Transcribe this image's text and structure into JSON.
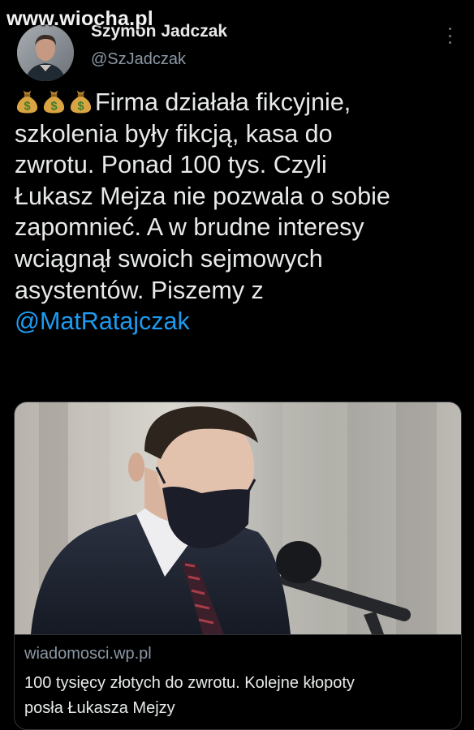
{
  "watermark": "www.wiocha.pl",
  "author": {
    "name": "Szymon Jadczak",
    "handle": "@SzJadczak"
  },
  "tweet": {
    "emoji_icons": [
      "money-bag-icon",
      "money-bag-icon",
      "money-bag-icon"
    ],
    "lines": [
      "Firma działała fikcyjnie,",
      "szkolenia były fikcją, kasa do",
      "zwrotu. Ponad 100 tys. Czyli",
      "Łukasz Mejza nie pozwala o sobie",
      "zapomnieć. A w brudne interesy",
      "wciągnął swoich sejmowych",
      "asystentów. Piszemy z"
    ],
    "mention": "@MatRatajczak"
  },
  "card": {
    "domain": "wiadomosci.wp.pl",
    "title_line1": "100 tysięcy złotych do zwrotu. Kolejne kłopoty",
    "title_line2": "posła Łukasza Mejzy"
  },
  "colors": {
    "background": "#000000",
    "text": "#e7e9ea",
    "secondary": "#8b98a5",
    "link": "#1d9bf0",
    "border": "#2f3336"
  }
}
